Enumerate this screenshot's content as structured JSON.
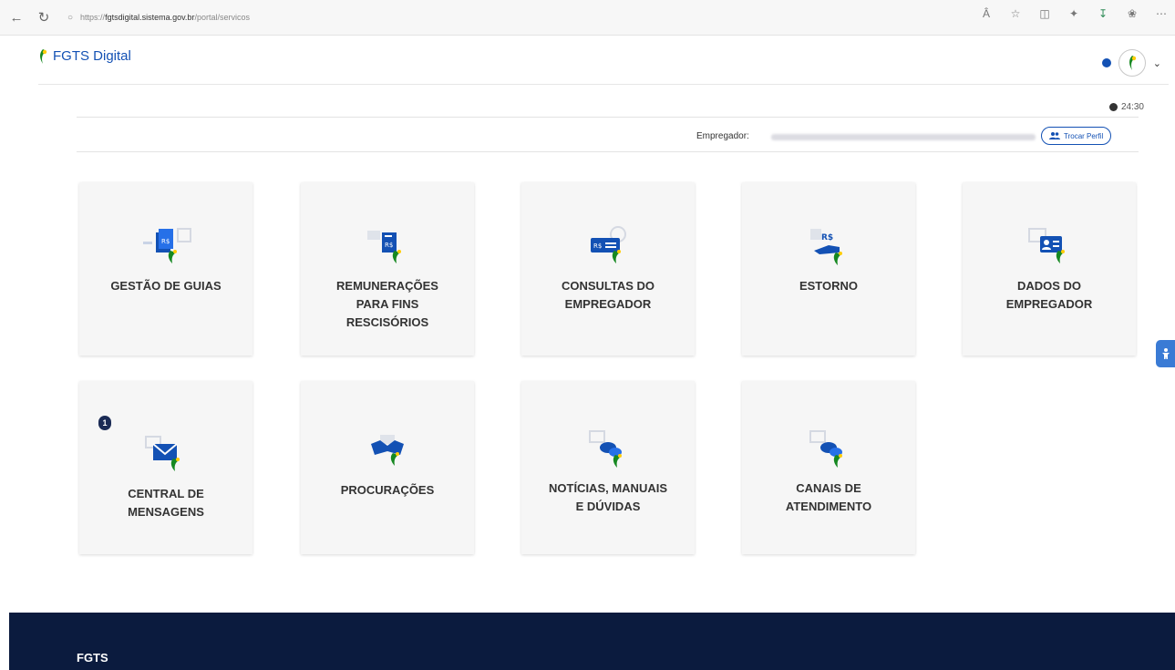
{
  "browser": {
    "url_scheme": "https://",
    "url_host": "fgtsdigital.sistema.gov.br",
    "url_path": "/portal/servicos"
  },
  "header": {
    "title": "FGTS Digital"
  },
  "session": {
    "timer": "24:30",
    "employer_label": "Empregador:",
    "switch_profile_label": "Trocar Perfil"
  },
  "cards": [
    {
      "label": "GESTÃO DE GUIAS"
    },
    {
      "label": "REMUNERAÇÕES\nPARA FINS\nRESCISÓRIOS"
    },
    {
      "label": "CONSULTAS DO\nEMPREGADOR"
    },
    {
      "label": "ESTORNO"
    },
    {
      "label": "DADOS DO\nEMPREGADOR"
    },
    {
      "label": "CENTRAL DE\nMENSAGENS",
      "badge": "1"
    },
    {
      "label": "PROCURAÇÕES"
    },
    {
      "label": "NOTÍCIAS, MANUAIS\nE DÚVIDAS"
    },
    {
      "label": "CANAIS DE\nATENDIMENTO"
    }
  ],
  "footer": {
    "logo": "FGTS"
  },
  "colors": {
    "primary": "#1351b4",
    "accent_green": "#168821",
    "accent_yellow": "#ffcd07",
    "footer_bg": "#0b1b3e",
    "card_bg": "#f6f6f6"
  }
}
